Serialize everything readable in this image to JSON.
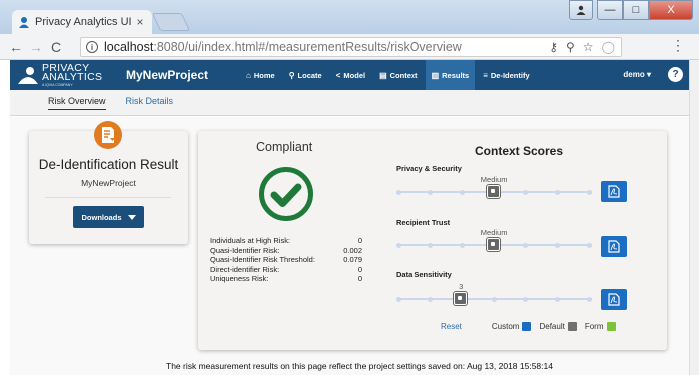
{
  "browser": {
    "tab_title": "Privacy Analytics UI - Me",
    "tab_close": "×",
    "url_host": "localhost",
    "url_rest": ":8080/ui/index.html#/measurementResults/riskOverview",
    "nav_back": "←",
    "nav_forward": "→",
    "nav_reload": "C",
    "info_glyph": "i",
    "menu_glyph": "⋮",
    "window_min": "—",
    "window_max": "□",
    "window_close": "X"
  },
  "app": {
    "logo_line1": "PRIVACY",
    "logo_line2": "ANALYTICS",
    "logo_sub": "A IQVIA COMPANY",
    "project": "MyNewProject",
    "nav_items": [
      {
        "label": "Home",
        "icon": "home-icon",
        "glyph": "⌂"
      },
      {
        "label": "Locate",
        "icon": "location-icon",
        "glyph": "⚲"
      },
      {
        "label": "Model",
        "icon": "share-icon",
        "glyph": "<"
      },
      {
        "label": "Context",
        "icon": "context-icon",
        "glyph": "▤"
      },
      {
        "label": "Results",
        "icon": "results-icon",
        "glyph": "▥"
      },
      {
        "label": "De-Identify",
        "icon": "deidentify-icon",
        "glyph": "≡"
      }
    ],
    "active_nav": "Results",
    "user": "demo",
    "help_glyph": "?"
  },
  "subtabs": {
    "overview": "Risk Overview",
    "details": "Risk Details"
  },
  "deid": {
    "title": "De-Identification Result",
    "project": "MyNewProject",
    "downloads": "Downloads"
  },
  "compliance": {
    "status": "Compliant",
    "metrics": [
      {
        "label": "Individuals at High Risk:",
        "value": "0"
      },
      {
        "label": "Quasi-Identifier Risk:",
        "value": "0.002"
      },
      {
        "label": "Quasi-Identifier Risk Threshold:",
        "value": "0.079"
      },
      {
        "label": "Direct-identifier Risk:",
        "value": "0"
      },
      {
        "label": "Uniqueness Risk:",
        "value": "0"
      }
    ]
  },
  "context_scores": {
    "title": "Context Scores",
    "items": [
      {
        "label": "Privacy & Security",
        "value": "Medium",
        "position": 0.5
      },
      {
        "label": "Recipient Trust",
        "value": "Medium",
        "position": 0.5
      },
      {
        "label": "Data Sensitivity",
        "value": "3",
        "position": 0.333
      }
    ],
    "reset": "Reset",
    "legend": [
      {
        "label": "Custom",
        "color": "#1b6ec2"
      },
      {
        "label": "Default",
        "color": "#707070"
      },
      {
        "label": "Form",
        "color": "#7cc23a"
      }
    ]
  },
  "colors": {
    "navbar": "#1b4e7a",
    "accent_orange": "#e07b1f",
    "success_green": "#1f7a3a"
  },
  "footer": {
    "note": "The risk measurement results on this page reflect the project settings saved on: Aug 13, 2018 15:58:14"
  }
}
